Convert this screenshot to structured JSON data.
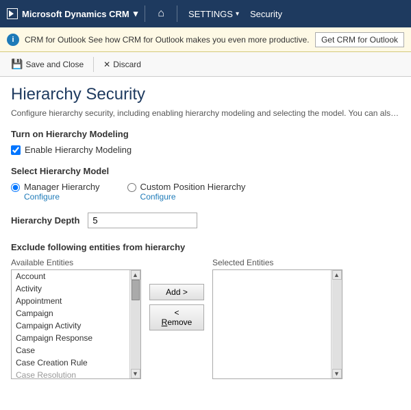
{
  "nav": {
    "brand": "Microsoft Dynamics CRM",
    "brand_chevron": "▾",
    "home_icon": "⌂",
    "settings_label": "SETTINGS",
    "settings_chevron": "▾",
    "security_label": "Security"
  },
  "info_bar": {
    "text": "CRM for Outlook  See how CRM for Outlook makes you even more productive.",
    "button_label": "Get CRM for Outlook"
  },
  "toolbar": {
    "save_close_label": "Save and Close",
    "discard_label": "Discard"
  },
  "page": {
    "title": "Hierarchy Security",
    "description": "Configure hierarchy security, including enabling hierarchy modeling and selecting the model. You can also specify h"
  },
  "turn_on_section": {
    "title": "Turn on Hierarchy Modeling",
    "checkbox_label": "Enable Hierarchy Modeling",
    "checked": true
  },
  "hierarchy_model": {
    "title": "Select Hierarchy Model",
    "options": [
      {
        "label": "Manager Hierarchy",
        "configure": "Configure",
        "selected": true
      },
      {
        "label": "Custom Position Hierarchy",
        "configure": "Configure",
        "selected": false
      }
    ]
  },
  "hierarchy_depth": {
    "label": "Hierarchy Depth",
    "value": "5"
  },
  "entities": {
    "title": "Exclude following entities from hierarchy",
    "available_label": "Available Entities",
    "selected_label": "Selected Entities",
    "add_button": "Add >",
    "remove_button": "< Remove",
    "available_items": [
      "Account",
      "Activity",
      "Appointment",
      "Campaign",
      "Campaign Activity",
      "Campaign Response",
      "Case",
      "Case Creation Rule",
      "Case Resolution"
    ],
    "selected_items": []
  }
}
